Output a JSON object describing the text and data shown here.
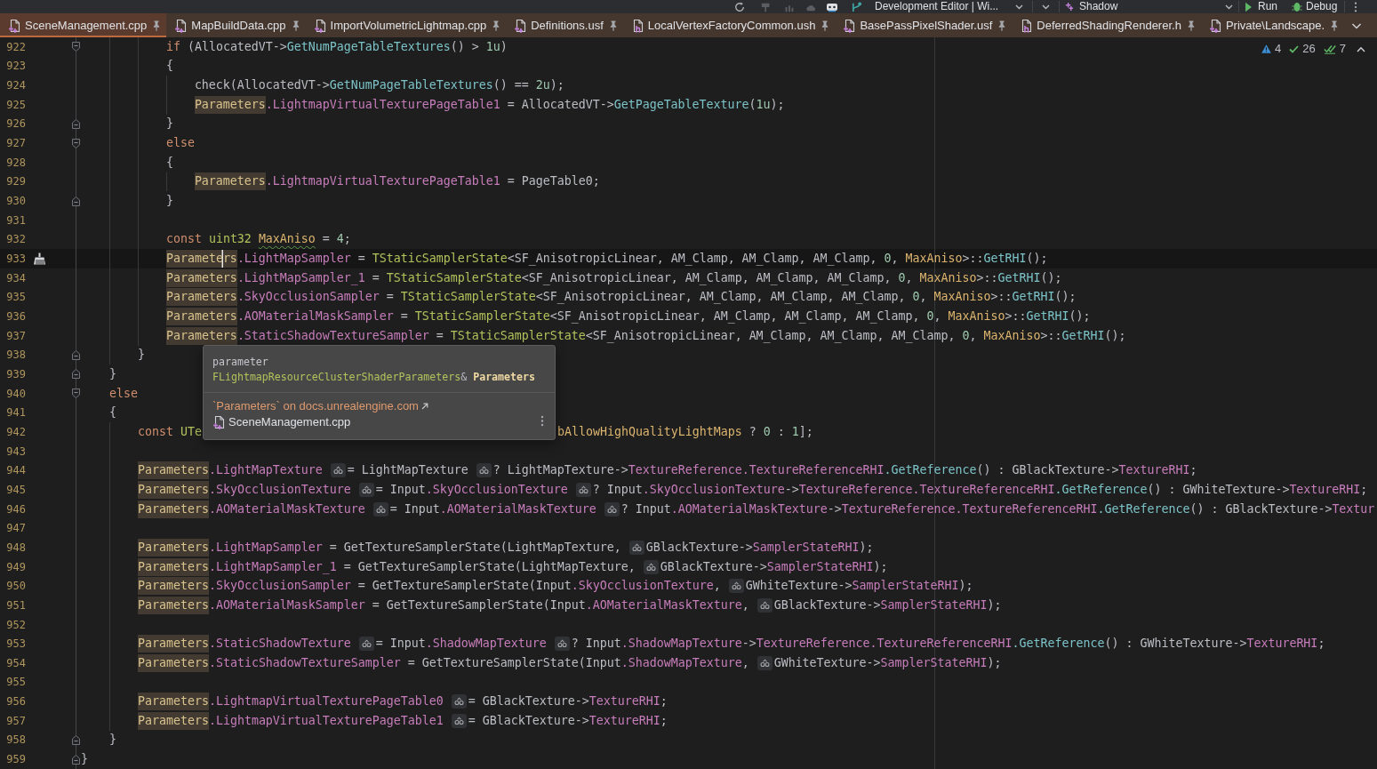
{
  "toolbar": {
    "configuration": "Development Editor | Wi...",
    "target": "Shadow",
    "actions": [
      {
        "kind": "run",
        "label": "Run"
      },
      {
        "kind": "debug",
        "label": "Debug"
      }
    ]
  },
  "tabs": [
    {
      "label": "SceneManagement.cpp",
      "kind": "source",
      "selected": true,
      "pinned": true
    },
    {
      "label": "MapBuildData.cpp",
      "kind": "source",
      "selected": false,
      "pinned": true
    },
    {
      "label": "ImportVolumetricLightmap.cpp",
      "kind": "source",
      "selected": false,
      "pinned": true
    },
    {
      "label": "Definitions.usf",
      "kind": "source",
      "selected": false,
      "pinned": true
    },
    {
      "label": "LocalVertexFactoryCommon.ush",
      "kind": "header",
      "selected": false,
      "pinned": true
    },
    {
      "label": "BasePassPixelShader.usf",
      "kind": "source",
      "selected": false,
      "pinned": true
    },
    {
      "label": "DeferredShadingRenderer.h",
      "kind": "header",
      "selected": false,
      "pinned": true
    },
    {
      "label": "Private\\Landscape.",
      "kind": "source",
      "selected": false,
      "pinned": true
    }
  ],
  "inspections": [
    {
      "kind": "warning",
      "count": "4"
    },
    {
      "kind": "passed",
      "count": "26"
    },
    {
      "kind": "typo",
      "count": "7"
    }
  ],
  "lines": [
    {
      "number": "922",
      "fold": {
        "kind": "start"
      },
      "current": false,
      "intention": false,
      "segments": [
        {
          "kind": "code",
          "tokens": [
            {
              "kind": "keyword",
              "text": "            if"
            },
            {
              "kind": "plain",
              "text": " (AllocatedVT->"
            },
            {
              "kind": "method",
              "text": "GetNumPageTableTextures"
            },
            {
              "kind": "plain",
              "text": "() > "
            },
            {
              "kind": "number",
              "text": "1u"
            },
            {
              "kind": "plain",
              "text": ")"
            }
          ]
        }
      ]
    },
    {
      "number": "923",
      "current": false,
      "intention": false,
      "segments": [
        {
          "kind": "code",
          "tokens": [
            {
              "kind": "plain",
              "text": "            {"
            }
          ]
        }
      ]
    },
    {
      "number": "924",
      "current": false,
      "intention": false,
      "segments": [
        {
          "kind": "code",
          "tokens": [
            {
              "kind": "plain",
              "text": "                check(AllocatedVT->"
            },
            {
              "kind": "method",
              "text": "GetNumPageTableTextures"
            },
            {
              "kind": "plain",
              "text": "() == "
            },
            {
              "kind": "number",
              "text": "2u"
            },
            {
              "kind": "plain",
              "text": ");"
            }
          ]
        }
      ]
    },
    {
      "number": "925",
      "current": false,
      "intention": false,
      "segments": [
        {
          "kind": "code",
          "tokens": [
            {
              "kind": "param",
              "text": "                Parameters"
            },
            {
              "kind": "field",
              "text": ".LightmapVirtualTexturePageTable1"
            },
            {
              "kind": "plain",
              "text": " = AllocatedVT->"
            },
            {
              "kind": "method",
              "text": "GetPageTableTexture"
            },
            {
              "kind": "plain",
              "text": "("
            },
            {
              "kind": "number",
              "text": "1u"
            },
            {
              "kind": "plain",
              "text": ");"
            }
          ]
        }
      ]
    },
    {
      "number": "926",
      "fold": {
        "kind": "end"
      },
      "current": false,
      "intention": false,
      "segments": [
        {
          "kind": "code",
          "tokens": [
            {
              "kind": "plain",
              "text": "            }"
            }
          ]
        }
      ]
    },
    {
      "number": "927",
      "fold": {
        "kind": "start"
      },
      "current": false,
      "intention": false,
      "segments": [
        {
          "kind": "code",
          "tokens": [
            {
              "kind": "keyword",
              "text": "            else"
            }
          ]
        }
      ]
    },
    {
      "number": "928",
      "current": false,
      "intention": false,
      "segments": [
        {
          "kind": "code",
          "tokens": [
            {
              "kind": "plain",
              "text": "            {"
            }
          ]
        }
      ]
    },
    {
      "number": "929",
      "current": false,
      "intention": false,
      "segments": [
        {
          "kind": "code",
          "tokens": [
            {
              "kind": "param",
              "text": "                Parameters"
            },
            {
              "kind": "field",
              "text": ".LightmapVirtualTexturePageTable1"
            },
            {
              "kind": "plain",
              "text": " = PageTable0;"
            }
          ]
        }
      ]
    },
    {
      "number": "930",
      "fold": {
        "kind": "end"
      },
      "current": false,
      "intention": false,
      "segments": [
        {
          "kind": "code",
          "tokens": [
            {
              "kind": "plain",
              "text": "            }"
            }
          ]
        }
      ]
    },
    {
      "number": "931",
      "current": false,
      "intention": false
    },
    {
      "number": "932",
      "current": false,
      "intention": false,
      "segments": [
        {
          "kind": "code",
          "tokens": [
            {
              "kind": "keyword",
              "text": "            const "
            },
            {
              "kind": "type",
              "text": "uint32 "
            },
            {
              "kind": "constant",
              "text": "MaxAniso",
              "squiggle": true
            },
            {
              "kind": "plain",
              "text": " = "
            },
            {
              "kind": "number",
              "text": "4"
            },
            {
              "kind": "plain",
              "text": ";"
            }
          ]
        }
      ]
    },
    {
      "number": "933",
      "current": true,
      "intention": true,
      "segments": [
        {
          "kind": "code",
          "tokens": [
            {
              "kind": "param",
              "text": "            Paramete",
              "caret": true
            },
            {
              "kind": "param",
              "text": "rs"
            },
            {
              "kind": "field",
              "text": ".LightMapSampler"
            },
            {
              "kind": "plain",
              "text": " = "
            },
            {
              "kind": "type",
              "text": "TStaticSamplerState"
            },
            {
              "kind": "plain",
              "text": "<SF_AnisotropicLinear, AM_Clamp, AM_Clamp, AM_Clamp, "
            },
            {
              "kind": "number",
              "text": "0"
            },
            {
              "kind": "plain",
              "text": ", "
            },
            {
              "kind": "constant",
              "text": "MaxAniso"
            },
            {
              "kind": "plain",
              "text": ">::"
            },
            {
              "kind": "method",
              "text": "GetRHI"
            },
            {
              "kind": "plain",
              "text": "();"
            }
          ]
        }
      ]
    },
    {
      "number": "934",
      "current": false,
      "intention": false,
      "segments": [
        {
          "kind": "code",
          "tokens": [
            {
              "kind": "param",
              "text": "            Parameters"
            },
            {
              "kind": "field",
              "text": ".LightMapSampler_1"
            },
            {
              "kind": "plain",
              "text": " = "
            },
            {
              "kind": "type",
              "text": "TStaticSamplerState"
            },
            {
              "kind": "plain",
              "text": "<SF_AnisotropicLinear, AM_Clamp, AM_Clamp, AM_Clamp, "
            },
            {
              "kind": "number",
              "text": "0"
            },
            {
              "kind": "plain",
              "text": ", "
            },
            {
              "kind": "constant",
              "text": "MaxAniso"
            },
            {
              "kind": "plain",
              "text": ">::"
            },
            {
              "kind": "method",
              "text": "GetRHI"
            },
            {
              "kind": "plain",
              "text": "();"
            }
          ]
        }
      ]
    },
    {
      "number": "935",
      "current": false,
      "intention": false,
      "segments": [
        {
          "kind": "code",
          "tokens": [
            {
              "kind": "param",
              "text": "            Parameters"
            },
            {
              "kind": "field",
              "text": ".SkyOcclusionSampler"
            },
            {
              "kind": "plain",
              "text": " = "
            },
            {
              "kind": "type",
              "text": "TStaticSamplerState"
            },
            {
              "kind": "plain",
              "text": "<SF_AnisotropicLinear, AM_Clamp, AM_Clamp, AM_Clamp, "
            },
            {
              "kind": "number",
              "text": "0"
            },
            {
              "kind": "plain",
              "text": ", "
            },
            {
              "kind": "constant",
              "text": "MaxAniso"
            },
            {
              "kind": "plain",
              "text": ">::"
            },
            {
              "kind": "method",
              "text": "GetRHI"
            },
            {
              "kind": "plain",
              "text": "();"
            }
          ]
        }
      ]
    },
    {
      "number": "936",
      "current": false,
      "intention": false,
      "segments": [
        {
          "kind": "code",
          "tokens": [
            {
              "kind": "param",
              "text": "            Parameters"
            },
            {
              "kind": "field",
              "text": ".AOMaterialMaskSampler"
            },
            {
              "kind": "plain",
              "text": " = "
            },
            {
              "kind": "type",
              "text": "TStaticSamplerState"
            },
            {
              "kind": "plain",
              "text": "<SF_AnisotropicLinear, AM_Clamp, AM_Clamp, AM_Clamp, "
            },
            {
              "kind": "number",
              "text": "0"
            },
            {
              "kind": "plain",
              "text": ", "
            },
            {
              "kind": "constant",
              "text": "MaxAniso"
            },
            {
              "kind": "plain",
              "text": ">::"
            },
            {
              "kind": "method",
              "text": "GetRHI"
            },
            {
              "kind": "plain",
              "text": "();"
            }
          ]
        }
      ]
    },
    {
      "number": "937",
      "current": false,
      "intention": false,
      "segments": [
        {
          "kind": "code",
          "tokens": [
            {
              "kind": "param",
              "text": "            Parameters"
            },
            {
              "kind": "field",
              "text": ".StaticShadowTextureSampler"
            },
            {
              "kind": "plain",
              "text": " = "
            },
            {
              "kind": "type",
              "text": "TStaticSamplerState"
            },
            {
              "kind": "plain",
              "text": "<SF_AnisotropicLinear, AM_Clamp, AM_Clamp, AM_Clamp, "
            },
            {
              "kind": "number",
              "text": "0"
            },
            {
              "kind": "plain",
              "text": ", "
            },
            {
              "kind": "constant",
              "text": "MaxAniso"
            },
            {
              "kind": "plain",
              "text": ">::"
            },
            {
              "kind": "method",
              "text": "GetRHI"
            },
            {
              "kind": "plain",
              "text": "();"
            }
          ]
        }
      ]
    },
    {
      "number": "938",
      "fold": {
        "kind": "end"
      },
      "current": false,
      "intention": false,
      "segments": [
        {
          "kind": "code",
          "tokens": [
            {
              "kind": "plain",
              "text": "        }"
            }
          ]
        }
      ]
    },
    {
      "number": "939",
      "fold": {
        "kind": "end"
      },
      "current": false,
      "intention": false,
      "segments": [
        {
          "kind": "code",
          "tokens": [
            {
              "kind": "plain",
              "text": "    }"
            }
          ]
        }
      ]
    },
    {
      "number": "940",
      "fold": {
        "kind": "start"
      },
      "current": false,
      "intention": false,
      "segments": [
        {
          "kind": "code",
          "tokens": [
            {
              "kind": "keyword",
              "text": "    else"
            }
          ]
        }
      ]
    },
    {
      "number": "941",
      "current": false,
      "intention": false,
      "segments": [
        {
          "kind": "code",
          "tokens": [
            {
              "kind": "plain",
              "text": "    {"
            }
          ]
        }
      ]
    },
    {
      "number": "942",
      "current": false,
      "intention": false,
      "segments": [
        {
          "kind": "code",
          "tokens": [
            {
              "kind": "keyword",
              "text": "        const "
            },
            {
              "kind": "type",
              "text": "UTe"
            }
          ]
        },
        {
          "kind": "covered"
        },
        {
          "kind": "code",
          "tokens": [
            {
              "kind": "constant",
              "text": "bAllowHighQualityLightMaps"
            },
            {
              "kind": "plain",
              "text": " ? "
            },
            {
              "kind": "number",
              "text": "0"
            },
            {
              "kind": "plain",
              "text": " : "
            },
            {
              "kind": "number",
              "text": "1"
            },
            {
              "kind": "plain",
              "text": "];"
            }
          ]
        }
      ]
    },
    {
      "number": "943",
      "current": false,
      "intention": false
    },
    {
      "number": "944",
      "current": false,
      "intention": false,
      "segments": [
        {
          "kind": "code",
          "tokens": [
            {
              "kind": "param",
              "text": "        Parameters"
            },
            {
              "kind": "field",
              "text": ".LightMapTexture"
            }
          ]
        },
        {
          "kind": "hint"
        },
        {
          "kind": "code",
          "tokens": [
            {
              "kind": "plain",
              "text": "= LightMapTexture"
            }
          ]
        },
        {
          "kind": "hint"
        },
        {
          "kind": "code",
          "tokens": [
            {
              "kind": "plain",
              "text": "? LightMapTexture->"
            },
            {
              "kind": "field",
              "text": "TextureReference.TextureReferenceRHI"
            },
            {
              "kind": "method",
              "text": ".GetReference"
            },
            {
              "kind": "plain",
              "text": "() : GBlackTexture->"
            },
            {
              "kind": "field",
              "text": "TextureRHI"
            },
            {
              "kind": "plain",
              "text": ";"
            }
          ]
        }
      ]
    },
    {
      "number": "945",
      "current": false,
      "intention": false,
      "segments": [
        {
          "kind": "code",
          "tokens": [
            {
              "kind": "param",
              "text": "        Parameters"
            },
            {
              "kind": "field",
              "text": ".SkyOcclusionTexture"
            }
          ]
        },
        {
          "kind": "hint"
        },
        {
          "kind": "code",
          "tokens": [
            {
              "kind": "plain",
              "text": "= Input"
            },
            {
              "kind": "field",
              "text": ".SkyOcclusionTexture"
            }
          ]
        },
        {
          "kind": "hint"
        },
        {
          "kind": "code",
          "tokens": [
            {
              "kind": "plain",
              "text": "? Input"
            },
            {
              "kind": "field",
              "text": ".SkyOcclusionTexture"
            },
            {
              "kind": "plain",
              "text": "->"
            },
            {
              "kind": "field",
              "text": "TextureReference.TextureReferenceRHI"
            },
            {
              "kind": "method",
              "text": ".GetReference"
            },
            {
              "kind": "plain",
              "text": "() : GWhiteTexture->"
            },
            {
              "kind": "field",
              "text": "TextureRHI"
            },
            {
              "kind": "plain",
              "text": ";"
            }
          ]
        }
      ]
    },
    {
      "number": "946",
      "current": false,
      "intention": false,
      "segments": [
        {
          "kind": "code",
          "tokens": [
            {
              "kind": "param",
              "text": "        Parameters"
            },
            {
              "kind": "field",
              "text": ".AOMaterialMaskTexture"
            }
          ]
        },
        {
          "kind": "hint"
        },
        {
          "kind": "code",
          "tokens": [
            {
              "kind": "plain",
              "text": "= Input"
            },
            {
              "kind": "field",
              "text": ".AOMaterialMaskTexture"
            }
          ]
        },
        {
          "kind": "hint"
        },
        {
          "kind": "code",
          "tokens": [
            {
              "kind": "plain",
              "text": "? Input"
            },
            {
              "kind": "field",
              "text": ".AOMaterialMaskTexture"
            },
            {
              "kind": "plain",
              "text": "->"
            },
            {
              "kind": "field",
              "text": "TextureReference.TextureReferenceRHI"
            },
            {
              "kind": "method",
              "text": ".GetReference"
            },
            {
              "kind": "plain",
              "text": "() : GBlackTexture->"
            },
            {
              "kind": "field",
              "text": "Textur"
            }
          ]
        }
      ]
    },
    {
      "number": "947",
      "current": false,
      "intention": false
    },
    {
      "number": "948",
      "current": false,
      "intention": false,
      "segments": [
        {
          "kind": "code",
          "tokens": [
            {
              "kind": "param",
              "text": "        Parameters"
            },
            {
              "kind": "field",
              "text": ".LightMapSampler"
            },
            {
              "kind": "plain",
              "text": " = GetTextureSamplerState(LightMapTexture,"
            }
          ]
        },
        {
          "kind": "hint"
        },
        {
          "kind": "code",
          "tokens": [
            {
              "kind": "plain",
              "text": "GBlackTexture->"
            },
            {
              "kind": "field",
              "text": "SamplerStateRHI"
            },
            {
              "kind": "plain",
              "text": ");"
            }
          ]
        }
      ]
    },
    {
      "number": "949",
      "current": false,
      "intention": false,
      "segments": [
        {
          "kind": "code",
          "tokens": [
            {
              "kind": "param",
              "text": "        Parameters"
            },
            {
              "kind": "field",
              "text": ".LightMapSampler_1"
            },
            {
              "kind": "plain",
              "text": " = GetTextureSamplerState(LightMapTexture,"
            }
          ]
        },
        {
          "kind": "hint"
        },
        {
          "kind": "code",
          "tokens": [
            {
              "kind": "plain",
              "text": "GBlackTexture->"
            },
            {
              "kind": "field",
              "text": "SamplerStateRHI"
            },
            {
              "kind": "plain",
              "text": ");"
            }
          ]
        }
      ]
    },
    {
      "number": "950",
      "current": false,
      "intention": false,
      "segments": [
        {
          "kind": "code",
          "tokens": [
            {
              "kind": "param",
              "text": "        Parameters"
            },
            {
              "kind": "field",
              "text": ".SkyOcclusionSampler"
            },
            {
              "kind": "plain",
              "text": " = GetTextureSamplerState(Input"
            },
            {
              "kind": "field",
              "text": ".SkyOcclusionTexture"
            },
            {
              "kind": "plain",
              "text": ","
            }
          ]
        },
        {
          "kind": "hint"
        },
        {
          "kind": "code",
          "tokens": [
            {
              "kind": "plain",
              "text": "GWhiteTexture->"
            },
            {
              "kind": "field",
              "text": "SamplerStateRHI"
            },
            {
              "kind": "plain",
              "text": ");"
            }
          ]
        }
      ]
    },
    {
      "number": "951",
      "current": false,
      "intention": false,
      "segments": [
        {
          "kind": "code",
          "tokens": [
            {
              "kind": "param",
              "text": "        Parameters"
            },
            {
              "kind": "field",
              "text": ".AOMaterialMaskSampler"
            },
            {
              "kind": "plain",
              "text": " = GetTextureSamplerState(Input"
            },
            {
              "kind": "field",
              "text": ".AOMaterialMaskTexture"
            },
            {
              "kind": "plain",
              "text": ","
            }
          ]
        },
        {
          "kind": "hint"
        },
        {
          "kind": "code",
          "tokens": [
            {
              "kind": "plain",
              "text": "GBlackTexture->"
            },
            {
              "kind": "field",
              "text": "SamplerStateRHI"
            },
            {
              "kind": "plain",
              "text": ");"
            }
          ]
        }
      ]
    },
    {
      "number": "952",
      "current": false,
      "intention": false
    },
    {
      "number": "953",
      "current": false,
      "intention": false,
      "segments": [
        {
          "kind": "code",
          "tokens": [
            {
              "kind": "param",
              "text": "        Parameters"
            },
            {
              "kind": "field",
              "text": ".StaticShadowTexture"
            }
          ]
        },
        {
          "kind": "hint"
        },
        {
          "kind": "code",
          "tokens": [
            {
              "kind": "plain",
              "text": "= Input"
            },
            {
              "kind": "field",
              "text": ".ShadowMapTexture"
            }
          ]
        },
        {
          "kind": "hint"
        },
        {
          "kind": "code",
          "tokens": [
            {
              "kind": "plain",
              "text": "? Input"
            },
            {
              "kind": "field",
              "text": ".ShadowMapTexture"
            },
            {
              "kind": "plain",
              "text": "->"
            },
            {
              "kind": "field",
              "text": "TextureReference.TextureReferenceRHI"
            },
            {
              "kind": "method",
              "text": ".GetReference"
            },
            {
              "kind": "plain",
              "text": "() : GWhiteTexture->"
            },
            {
              "kind": "field",
              "text": "TextureRHI"
            },
            {
              "kind": "plain",
              "text": ";"
            }
          ]
        }
      ]
    },
    {
      "number": "954",
      "current": false,
      "intention": false,
      "segments": [
        {
          "kind": "code",
          "tokens": [
            {
              "kind": "param",
              "text": "        Parameters"
            },
            {
              "kind": "field",
              "text": ".StaticShadowTextureSampler"
            },
            {
              "kind": "plain",
              "text": " = GetTextureSamplerState(Input"
            },
            {
              "kind": "field",
              "text": ".ShadowMapTexture"
            },
            {
              "kind": "plain",
              "text": ","
            }
          ]
        },
        {
          "kind": "hint"
        },
        {
          "kind": "code",
          "tokens": [
            {
              "kind": "plain",
              "text": "GWhiteTexture->"
            },
            {
              "kind": "field",
              "text": "SamplerStateRHI"
            },
            {
              "kind": "plain",
              "text": ");"
            }
          ]
        }
      ]
    },
    {
      "number": "955",
      "current": false,
      "intention": false
    },
    {
      "number": "956",
      "current": false,
      "intention": false,
      "segments": [
        {
          "kind": "code",
          "tokens": [
            {
              "kind": "param",
              "text": "        Parameters"
            },
            {
              "kind": "field",
              "text": ".LightmapVirtualTexturePageTable0"
            }
          ]
        },
        {
          "kind": "hint"
        },
        {
          "kind": "code",
          "tokens": [
            {
              "kind": "plain",
              "text": "= GBlackTexture->"
            },
            {
              "kind": "field",
              "text": "TextureRHI"
            },
            {
              "kind": "plain",
              "text": ";"
            }
          ]
        }
      ]
    },
    {
      "number": "957",
      "current": false,
      "intention": false,
      "segments": [
        {
          "kind": "code",
          "tokens": [
            {
              "kind": "param",
              "text": "        Parameters"
            },
            {
              "kind": "field",
              "text": ".LightmapVirtualTexturePageTable1"
            }
          ]
        },
        {
          "kind": "hint"
        },
        {
          "kind": "code",
          "tokens": [
            {
              "kind": "plain",
              "text": "= GBlackTexture->"
            },
            {
              "kind": "field",
              "text": "TextureRHI"
            },
            {
              "kind": "plain",
              "text": ";"
            }
          ]
        }
      ]
    },
    {
      "number": "958",
      "fold": {
        "kind": "end"
      },
      "current": false,
      "intention": false,
      "segments": [
        {
          "kind": "code",
          "tokens": [
            {
              "kind": "plain",
              "text": "    }"
            }
          ]
        }
      ]
    },
    {
      "number": "959",
      "fold": {
        "kind": "end"
      },
      "current": false,
      "intention": false,
      "segments": [
        {
          "kind": "code",
          "tokens": [
            {
              "kind": "plain",
              "text": "}"
            }
          ]
        }
      ]
    }
  ],
  "tooltip": {
    "heading": "parameter",
    "signature": [
      {
        "kind": "type",
        "text": "FLightmapResourceClusterShaderParameters"
      },
      {
        "kind": "plain",
        "text": "& "
      },
      {
        "kind": "name",
        "text": "Parameters"
      }
    ],
    "link": "`Parameters` on docs.unrealengine.com",
    "file": "SceneManagement.cpp"
  }
}
